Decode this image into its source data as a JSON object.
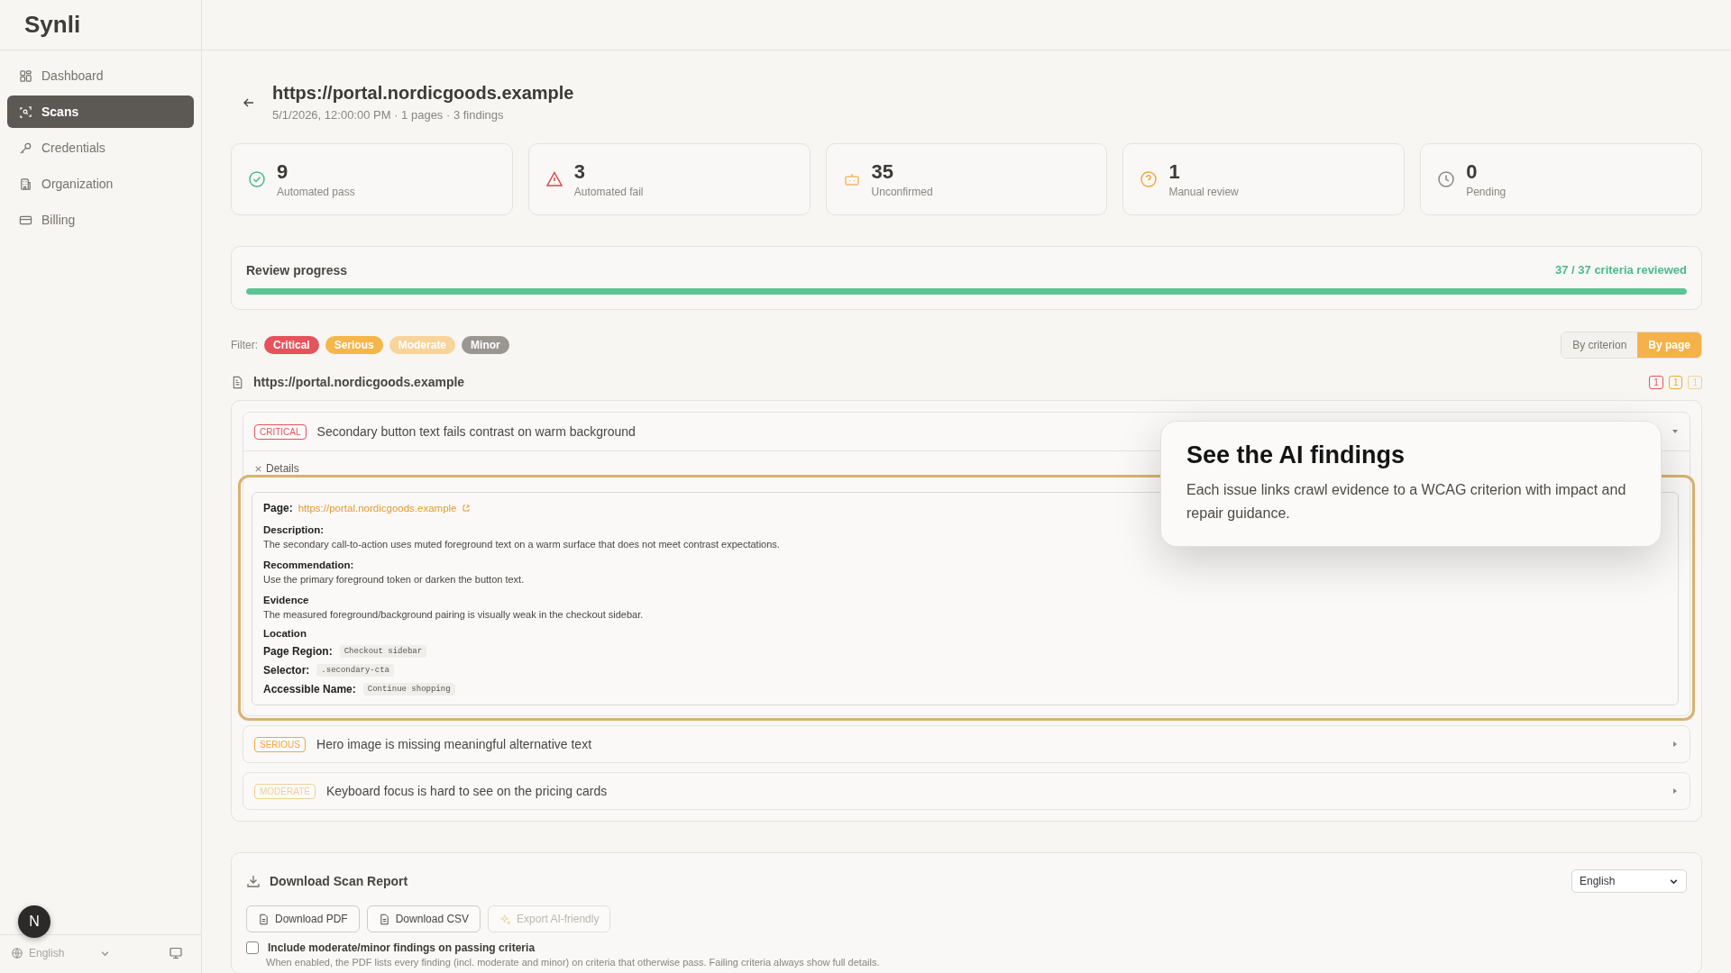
{
  "logo": "Synli",
  "sidebar": {
    "items": [
      {
        "label": "Dashboard",
        "selected": false
      },
      {
        "label": "Scans",
        "selected": true
      },
      {
        "label": "Credentials",
        "selected": false
      },
      {
        "label": "Organization",
        "selected": false
      },
      {
        "label": "Billing",
        "selected": false
      }
    ],
    "avatar": "N",
    "language": "English"
  },
  "header": {
    "title": "https://portal.nordicgoods.example",
    "subtitle": "5/1/2026, 12:00:00 PM · 1 pages · 3 findings"
  },
  "stats": [
    {
      "kind": "pass",
      "value": "9",
      "label": "Automated pass"
    },
    {
      "kind": "fail",
      "value": "3",
      "label": "Automated fail"
    },
    {
      "kind": "unconfirmed",
      "value": "35",
      "label": "Unconfirmed"
    },
    {
      "kind": "manual",
      "value": "1",
      "label": "Manual review"
    },
    {
      "kind": "pending",
      "value": "0",
      "label": "Pending"
    }
  ],
  "progress": {
    "title": "Review progress",
    "reading": "37 / 37 criteria reviewed",
    "level": 1
  },
  "filter": {
    "label": "Filter:",
    "chips": [
      {
        "label": "Critical",
        "color": "#e5535b"
      },
      {
        "label": "Serious",
        "color": "#f5b64a"
      },
      {
        "label": "Moderate",
        "color": "#f8d39a"
      },
      {
        "label": "Minor",
        "color": "#9a9793"
      }
    ]
  },
  "view_toggle": [
    {
      "label": "By criterion",
      "selected": false
    },
    {
      "label": "By page",
      "selected": true
    }
  ],
  "page_group": {
    "url": "https://portal.nordicgoods.example",
    "counts": [
      {
        "text": "1",
        "color": "#e5535b"
      },
      {
        "text": "1",
        "color": "#f0a63c"
      },
      {
        "text": "1",
        "color": "#f3cf94"
      }
    ]
  },
  "findings": [
    {
      "severity": "CRITICAL",
      "color": "#e5535b",
      "title": "Secondary button text fails contrast on warm background",
      "expanded": true
    },
    {
      "severity": "SERIOUS",
      "color": "#f0a63c",
      "title": "Hero image is missing meaningful alternative text",
      "expanded": false
    },
    {
      "severity": "MODERATE",
      "color": "#f3cf94",
      "title": "Keyboard focus is hard to see on the pricing cards",
      "expanded": false
    }
  ],
  "details": {
    "toggle": "Details",
    "page_label": "Page:",
    "page_url": "https://portal.nordicgoods.example",
    "sections": [
      {
        "label": "Description:",
        "text": "The secondary call-to-action uses muted foreground text on a warm surface that does not meet contrast expectations."
      },
      {
        "label": "Recommendation:",
        "text": "Use the primary foreground token or darken the button text."
      },
      {
        "label": "Evidence",
        "text": "The measured foreground/background pairing is visually weak in the checkout sidebar."
      }
    ],
    "location_label": "Location",
    "location": [
      {
        "label": "Page Region:",
        "value": "Checkout sidebar"
      },
      {
        "label": "Selector:",
        "value": ".secondary-cta"
      },
      {
        "label": "Accessible Name:",
        "value": "Continue shopping"
      }
    ]
  },
  "tour": {
    "title": "See the AI findings",
    "body": "Each issue links crawl evidence to a WCAG criterion with impact and repair guidance."
  },
  "report": {
    "title": "Download Scan Report",
    "language": "English",
    "buttons": [
      {
        "label": "Download PDF",
        "disabled": false
      },
      {
        "label": "Download CSV",
        "disabled": false
      },
      {
        "label": "Export AI-friendly",
        "disabled": true
      }
    ],
    "option": {
      "label": "Include moderate/minor findings on passing criteria",
      "checked": false,
      "hint": "When enabled, the PDF lists every finding (incl. moderate and minor) on criteria that otherwise pass. Failing criteria always show full details."
    }
  }
}
